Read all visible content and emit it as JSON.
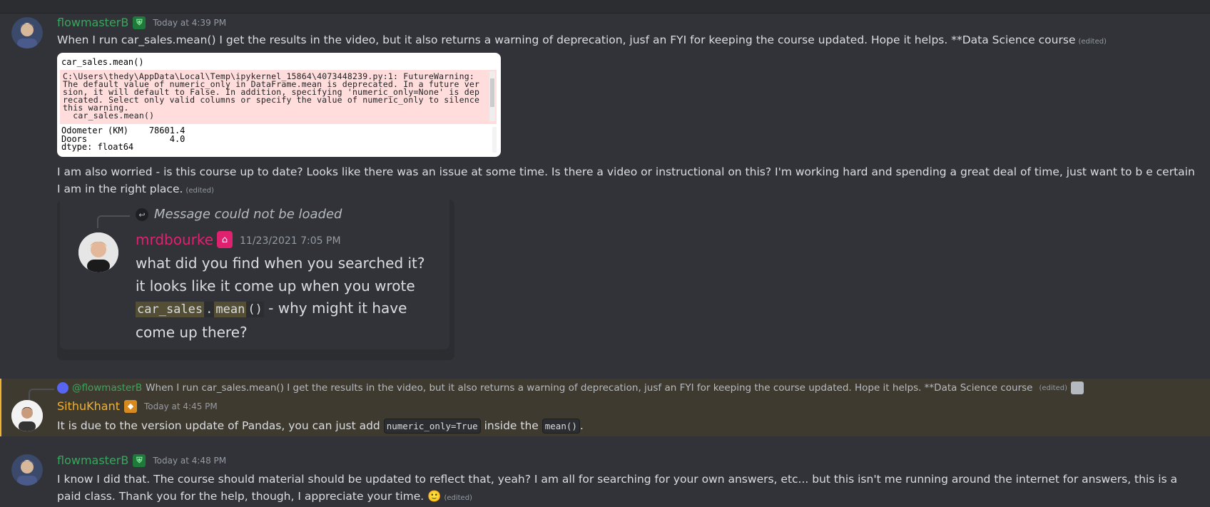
{
  "messages": {
    "m1": {
      "username": "flowmasterB",
      "username_color": "#3ba55d",
      "timestamp": "Today at 4:39 PM",
      "text": "When I run car_sales.mean() I get the results in the video, but it also returns a warning of deprecation, jusf an FYI for keeping the course updated. Hope it helps. **Data Science course",
      "edited": "(edited)",
      "attachment": {
        "code_line": "car_sales.mean()",
        "warning": "C:\\Users\\thedy\\AppData\\Local\\Temp\\ipykernel_15864\\4073448239.py:1: FutureWarning: The default value of numeric_only in DataFrame.mean is deprecated. In a future version, it will default to False. In addition, specifying 'numeric_only=None' is deprecated. Select only valid columns or specify the value of numeric_only to silence this warning.\n  car_sales.mean()",
        "output": "Odometer (KM)    78601.4\nDoors                4.0\ndtype: float64"
      },
      "text2": "I am also worried  - is this course up to date? Looks like there was an issue at some time. Is there a video or instructional on this? I'm working hard and spending a great deal of time, just want to b e certain I am in the right place.",
      "edited2": "(edited)",
      "quote_image": {
        "reply_text": "Message could not be loaded",
        "username": "mrdbourke",
        "timestamp": "11/23/2021 7:05 PM",
        "text_part1": "what did you find when you searched it? it looks like it come up when you wrote ",
        "code_a": "car_sales",
        "code_dot": ".",
        "code_b": "mean",
        "code_paren": "()",
        "text_part2": " - why might it have come up there?"
      }
    },
    "m2": {
      "ref_user": "@flowmasterB",
      "ref_text": "When I run car_sales.mean() I get the results in the video, but it also returns a warning of deprecation, jusf an FYI for keeping the course updated. Hope it helps. **Data Science course",
      "ref_edited": "(edited)",
      "username": "SithuKhant",
      "username_color": "#f0b232",
      "timestamp": "Today at 4:45 PM",
      "text_a": "It is due to the version update of Pandas, you can just add ",
      "code1": "numeric_only=True",
      "text_b": " inside the ",
      "code2": "mean()",
      "text_c": "."
    },
    "m3": {
      "username": "flowmasterB",
      "timestamp": "Today at 4:48 PM",
      "text": "I know I did that.  The course should material should be updated to reflect that, yeah? I am all for searching for your own answers, etc... but this isn't me running around the internet for answers, this is a paid class. Thank you for the help, though, I appreciate your time.",
      "emoji": "🙂",
      "edited": "(edited)"
    }
  }
}
